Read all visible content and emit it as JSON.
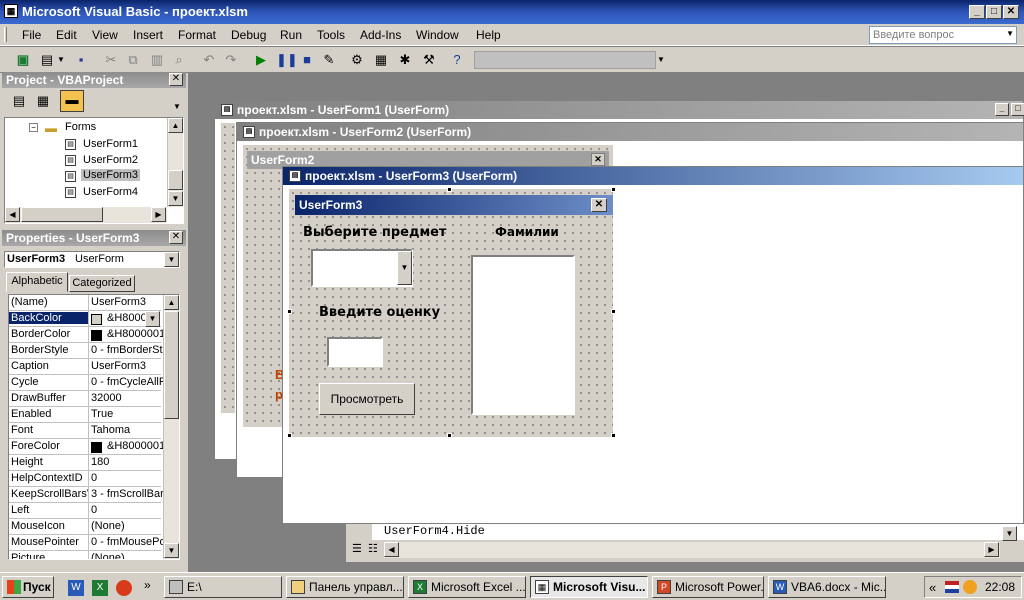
{
  "window": {
    "title": "Microsoft Visual Basic - проект.xlsm"
  },
  "menu": {
    "items": [
      "File",
      "Edit",
      "View",
      "Insert",
      "Format",
      "Debug",
      "Run",
      "Tools",
      "Add-Ins",
      "Window",
      "Help"
    ],
    "search_placeholder": "Введите вопрос"
  },
  "project": {
    "title": "Project - VBAProject",
    "folder": "Forms",
    "items": [
      "UserForm1",
      "UserForm2",
      "UserForm3",
      "UserForm4"
    ],
    "selected": "UserForm3"
  },
  "properties": {
    "title": "Properties - UserForm3",
    "object_name": "UserForm3",
    "object_type": "UserForm",
    "tabs": [
      "Alphabetic",
      "Categorized"
    ],
    "rows": [
      {
        "name": "(Name)",
        "value": "UserForm3"
      },
      {
        "name": "BackColor",
        "value": "&H8000"
      },
      {
        "name": "BorderColor",
        "value": "&H8000001"
      },
      {
        "name": "BorderStyle",
        "value": "0 - fmBorderSt"
      },
      {
        "name": "Caption",
        "value": "UserForm3"
      },
      {
        "name": "Cycle",
        "value": "0 - fmCycleAllF"
      },
      {
        "name": "DrawBuffer",
        "value": "32000"
      },
      {
        "name": "Enabled",
        "value": "True"
      },
      {
        "name": "Font",
        "value": "Tahoma"
      },
      {
        "name": "ForeColor",
        "value": "&H8000001"
      },
      {
        "name": "Height",
        "value": "180"
      },
      {
        "name": "HelpContextID",
        "value": "0"
      },
      {
        "name": "KeepScrollBarsVi",
        "value": "3 - fmScrollBar"
      },
      {
        "name": "Left",
        "value": "0"
      },
      {
        "name": "MouseIcon",
        "value": "(None)"
      },
      {
        "name": "MousePointer",
        "value": "0 - fmMousePo"
      },
      {
        "name": "Picture",
        "value": "(None)"
      }
    ],
    "selected_row": "BackColor"
  },
  "mdi": {
    "win1_title": "проект.xlsm - UserForm1 (UserForm)",
    "win2_title": "проект.xlsm - UserForm2 (UserForm)",
    "win2_form_caption": "UserForm2",
    "win3_title": "проект.xlsm - UserForm3 (UserForm)",
    "code_line": "UserForm4.Hide",
    "partial_glyphs": [
      "В",
      "р"
    ]
  },
  "form": {
    "caption": "UserForm3",
    "label_subject": "Выберите предмет",
    "label_surnames": "Фамилии",
    "label_grade": "Введите оценку",
    "button_view": "Просмотреть"
  },
  "taskbar": {
    "start": "Пуск",
    "tasks": [
      "E:\\",
      "Панель управл...",
      "Microsoft Excel ...",
      "Microsoft Visu...",
      "Microsoft Power...",
      "VBA6.docx - Mic..."
    ],
    "active_task": "Microsoft Visu...",
    "lang": "«",
    "time": "22:08"
  },
  "colors": {
    "title_active": "#0a246a",
    "title_inactive": "#808080",
    "selection": "#0a246a",
    "canvas": "#808080",
    "face": "#d4d0c8"
  }
}
